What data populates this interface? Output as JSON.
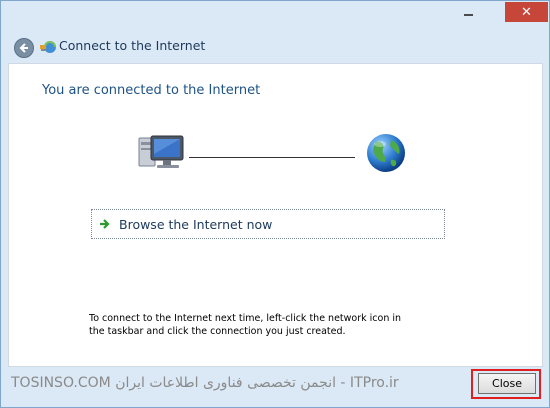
{
  "window": {
    "title": "Connect to the Internet",
    "close_glyph": "✕"
  },
  "main": {
    "heading": "You are connected to the Internet",
    "browse_label": "Browse the Internet now",
    "instructions": "To connect to the Internet next time, left-click the network icon in the taskbar and click the connection you just created."
  },
  "footer": {
    "watermark": "TOSINSO.COM انجمن تخصصی فناوری اطلاعات ایران - ITPro.ir",
    "close_label": "Close"
  },
  "icons": {
    "back": "back-arrow-icon",
    "network": "network-connection-icon",
    "computer": "computer-icon",
    "globe": "globe-icon",
    "browse_arrow": "green-arrow-icon"
  },
  "colors": {
    "accent_text": "#1e5287",
    "close_window_bg": "#c7463a",
    "highlight_border": "#e02020"
  }
}
